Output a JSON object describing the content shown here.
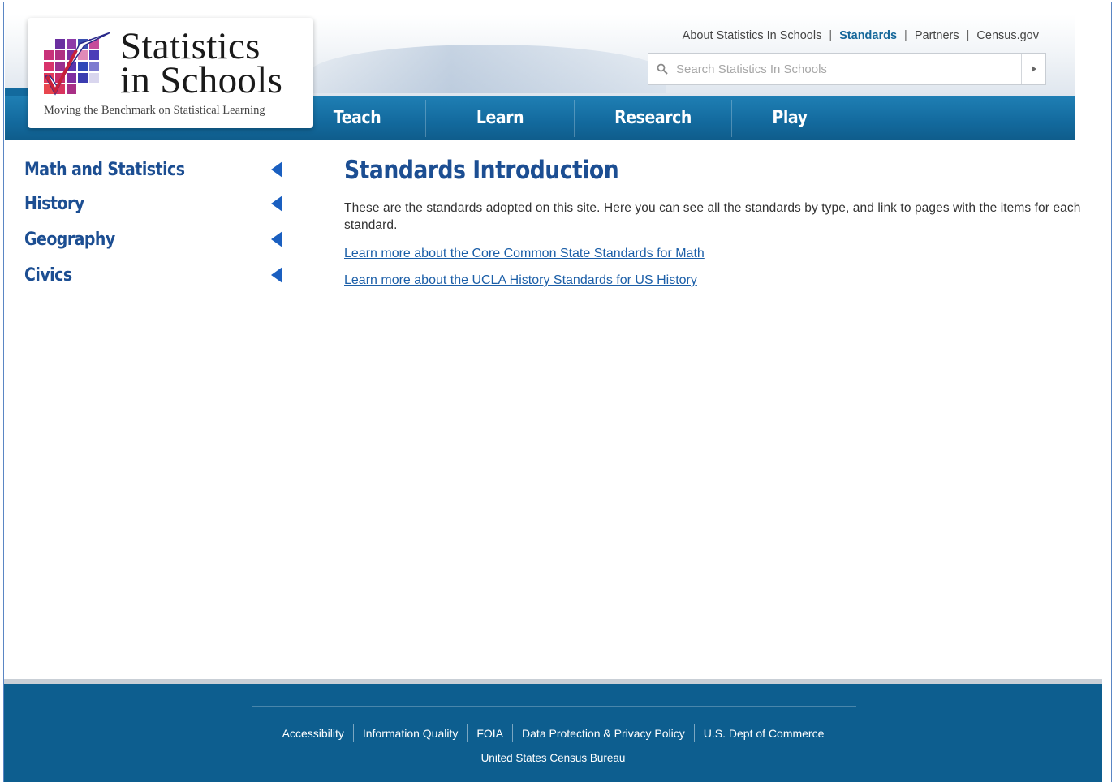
{
  "header": {
    "logo": {
      "title_line1": "Statistics",
      "title_line2": "in Schools",
      "tagline": "Moving the Benchmark on Statistical Learning"
    },
    "utility_links": [
      {
        "label": "About Statistics In Schools",
        "active": false
      },
      {
        "label": "Standards",
        "active": true
      },
      {
        "label": "Partners",
        "active": false
      },
      {
        "label": "Census.gov",
        "active": false
      }
    ],
    "search": {
      "placeholder": "Search Statistics In Schools",
      "icon": "search-icon",
      "submit_icon": "play-arrow-icon"
    },
    "nav": [
      {
        "label": "Teach"
      },
      {
        "label": "Learn"
      },
      {
        "label": "Research"
      },
      {
        "label": "Play"
      }
    ]
  },
  "sidebar": {
    "items": [
      {
        "label": "Math and Statistics",
        "icon": "arrow-left-icon"
      },
      {
        "label": "History",
        "icon": "arrow-left-icon"
      },
      {
        "label": "Geography",
        "icon": "arrow-left-icon"
      },
      {
        "label": "Civics",
        "icon": "arrow-left-icon"
      }
    ]
  },
  "main": {
    "title": "Standards Introduction",
    "intro": "These are the standards adopted on this site. Here you can see all the standards by type, and link to pages with the items for each standard.",
    "links": [
      {
        "label": "Learn more about the Core Common State Standards for Math"
      },
      {
        "label": "Learn more about the UCLA History Standards for US History"
      }
    ]
  },
  "footer": {
    "links": [
      {
        "label": "Accessibility"
      },
      {
        "label": "Information Quality"
      },
      {
        "label": "FOIA"
      },
      {
        "label": "Data Protection & Privacy Policy"
      },
      {
        "label": "U.S. Dept of Commerce"
      }
    ],
    "org": "United States Census Bureau"
  },
  "colors": {
    "brand_blue": "#1c4e92",
    "nav_blue": "#136a9e",
    "footer_blue": "#0d5e8f",
    "link_blue": "#1c5fa8"
  }
}
